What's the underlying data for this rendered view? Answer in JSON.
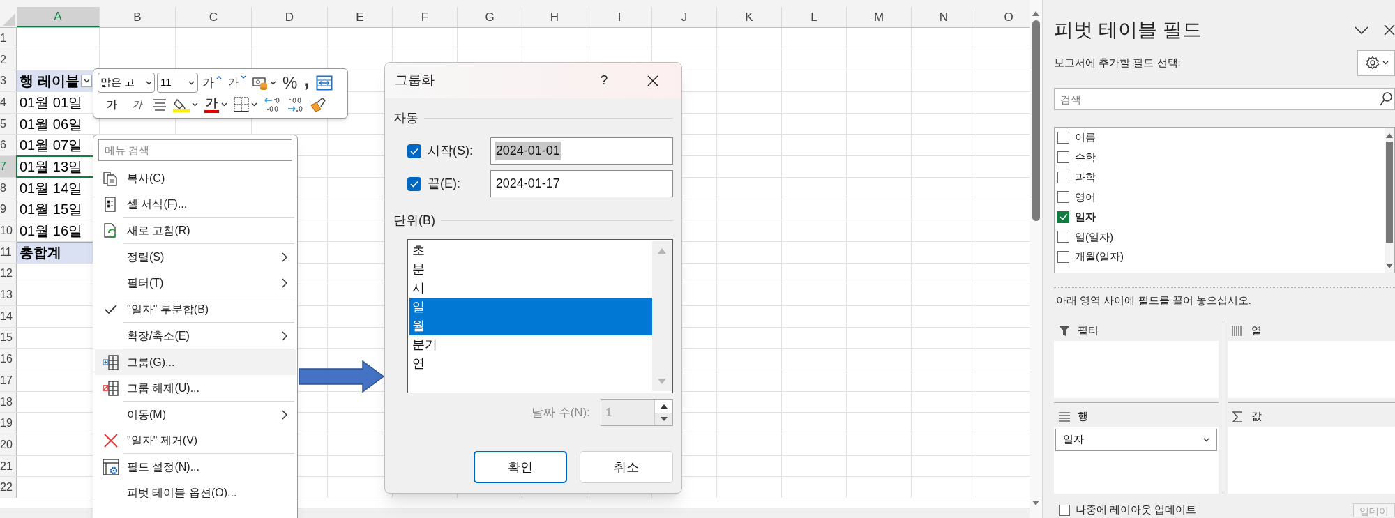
{
  "sheet": {
    "columns": [
      {
        "label": "A",
        "selected": true
      },
      {
        "label": "B",
        "selected": false
      },
      {
        "label": "C",
        "selected": false
      },
      {
        "label": "D",
        "selected": false
      },
      {
        "label": "E",
        "selected": false
      },
      {
        "label": "F",
        "selected": false
      },
      {
        "label": "G",
        "selected": false
      },
      {
        "label": "H",
        "selected": false
      },
      {
        "label": "I",
        "selected": false
      },
      {
        "label": "J",
        "selected": false
      },
      {
        "label": "K",
        "selected": false
      },
      {
        "label": "L",
        "selected": false
      },
      {
        "label": "M",
        "selected": false
      },
      {
        "label": "N",
        "selected": false
      },
      {
        "label": "O",
        "selected": false
      }
    ],
    "rows": [
      {
        "label": "1",
        "selected": false
      },
      {
        "label": "2",
        "selected": false
      },
      {
        "label": "3",
        "selected": false
      },
      {
        "label": "4",
        "selected": false
      },
      {
        "label": "5",
        "selected": false
      },
      {
        "label": "6",
        "selected": false
      },
      {
        "label": "7",
        "selected": true
      },
      {
        "label": "8",
        "selected": false
      },
      {
        "label": "9",
        "selected": false
      },
      {
        "label": "10",
        "selected": false
      },
      {
        "label": "11",
        "selected": false
      },
      {
        "label": "12",
        "selected": false
      },
      {
        "label": "13",
        "selected": false
      },
      {
        "label": "14",
        "selected": false
      },
      {
        "label": "15",
        "selected": false
      },
      {
        "label": "16",
        "selected": false
      },
      {
        "label": "17",
        "selected": false
      },
      {
        "label": "18",
        "selected": false
      },
      {
        "label": "19",
        "selected": false
      },
      {
        "label": "20",
        "selected": false
      },
      {
        "label": "21",
        "selected": false
      },
      {
        "label": "22",
        "selected": false
      }
    ]
  },
  "pivot_table": {
    "cells": [
      {
        "kind": "header",
        "text": "행 레이블",
        "selected": false
      },
      {
        "kind": "item",
        "text": "01월 01일",
        "selected": false
      },
      {
        "kind": "item",
        "text": "01월 06일",
        "selected": false
      },
      {
        "kind": "item",
        "text": "01월 07일",
        "selected": false
      },
      {
        "kind": "item",
        "text": "01월 13일",
        "selected": true
      },
      {
        "kind": "item",
        "text": "01월 14일",
        "selected": false
      },
      {
        "kind": "item",
        "text": "01월 15일",
        "selected": false
      },
      {
        "kind": "item",
        "text": "01월 16일",
        "selected": false
      },
      {
        "kind": "total",
        "text": "총합계",
        "selected": false
      }
    ]
  },
  "mini_toolbar": {
    "font": "맑은 고",
    "size": "11",
    "top_tools": [
      {
        "kind": "grow",
        "glyph": "가"
      },
      {
        "kind": "shrink",
        "glyph": "가"
      },
      {
        "kind": "accounting"
      },
      {
        "kind": "percent",
        "glyph": "%"
      },
      {
        "kind": "comma",
        "glyph": ","
      },
      {
        "kind": "wrap"
      }
    ],
    "bottom_tools": [
      {
        "kind": "bold",
        "glyph": "가"
      },
      {
        "kind": "italic",
        "glyph": "가"
      },
      {
        "kind": "align"
      },
      {
        "kind": "fill"
      },
      {
        "kind": "font_color",
        "glyph": "가"
      },
      {
        "kind": "borders"
      },
      {
        "kind": "increase_decimal"
      },
      {
        "kind": "decrease_decimal"
      },
      {
        "kind": "format_painter"
      }
    ]
  },
  "context_menu": {
    "search_placeholder": "메뉴 검색",
    "items": [
      {
        "kind": "copy",
        "label": "복사(C)",
        "submenu": false,
        "checked": false,
        "highlighted": false
      },
      {
        "kind": "format",
        "label": "셀 서식(F)...",
        "submenu": false,
        "checked": false,
        "highlighted": false
      },
      {
        "kind": "separator"
      },
      {
        "kind": "refresh",
        "label": "새로 고침(R)",
        "submenu": false,
        "checked": false,
        "highlighted": false
      },
      {
        "kind": "separator"
      },
      {
        "kind": "item",
        "label": "정렬(S)",
        "submenu": true,
        "checked": false,
        "highlighted": false
      },
      {
        "kind": "item",
        "label": "필터(T)",
        "submenu": true,
        "checked": false,
        "highlighted": false
      },
      {
        "kind": "separator"
      },
      {
        "kind": "item",
        "label": "\"일자\" 부분합(B)",
        "submenu": false,
        "checked": true,
        "highlighted": false
      },
      {
        "kind": "separator"
      },
      {
        "kind": "item",
        "label": "확장/축소(E)",
        "submenu": true,
        "checked": false,
        "highlighted": false
      },
      {
        "kind": "separator"
      },
      {
        "kind": "group",
        "label": "그룹(G)...",
        "submenu": false,
        "checked": false,
        "highlighted": true
      },
      {
        "kind": "ungroup",
        "label": "그룹 해제(U)...",
        "submenu": false,
        "checked": false,
        "highlighted": false
      },
      {
        "kind": "separator"
      },
      {
        "kind": "item",
        "label": "이동(M)",
        "submenu": true,
        "checked": false,
        "highlighted": false
      },
      {
        "kind": "remove",
        "label": "\"일자\" 제거(V)",
        "submenu": false,
        "checked": false,
        "highlighted": false
      },
      {
        "kind": "separator"
      },
      {
        "kind": "field_settings",
        "label": "필드 설정(N)...",
        "submenu": false,
        "checked": false,
        "highlighted": false
      },
      {
        "kind": "item",
        "label": "피벗 테이블 옵션(O)...",
        "submenu": false,
        "checked": false,
        "highlighted": false
      }
    ]
  },
  "group_dialog": {
    "title": "그룹화",
    "help": "?",
    "auto_section": "자동",
    "start": {
      "checked": true,
      "label": "시작(S):",
      "value": "2024-01-01",
      "value_selected": true
    },
    "end": {
      "checked": true,
      "label": "끝(E):",
      "value": "2024-01-17",
      "value_selected": false
    },
    "unit_section": "단위(B)",
    "units": [
      {
        "label": "초",
        "selected": false
      },
      {
        "label": "분",
        "selected": false
      },
      {
        "label": "시",
        "selected": false
      },
      {
        "label": "일",
        "selected": true
      },
      {
        "label": "월",
        "selected": true
      },
      {
        "label": "분기",
        "selected": false
      },
      {
        "label": "연",
        "selected": false
      }
    ],
    "days_label": "날짜 수(N):",
    "days_value": "1",
    "days_disabled": true,
    "buttons": [
      {
        "label": "확인",
        "default": true
      },
      {
        "label": "취소",
        "default": false
      }
    ]
  },
  "pivot_pane": {
    "title": "피벗 테이블 필드",
    "subtitle": "보고서에 추가할 필드 선택:",
    "search_placeholder": "검색",
    "fields": [
      {
        "label": "이름",
        "checked": false
      },
      {
        "label": "수학",
        "checked": false
      },
      {
        "label": "과학",
        "checked": false
      },
      {
        "label": "영어",
        "checked": false
      },
      {
        "label": "일자",
        "checked": true
      },
      {
        "label": "일(일자)",
        "checked": false
      },
      {
        "label": "개월(일자)",
        "checked": false
      }
    ],
    "instruction": "아래 영역 사이에 필드를 끌어 놓으십시오.",
    "areas": [
      {
        "kind": "filter",
        "label": "필터"
      },
      {
        "kind": "columns",
        "label": "열"
      },
      {
        "kind": "rows",
        "label": "행",
        "items": [
          "일자"
        ]
      },
      {
        "kind": "values",
        "label": "값"
      }
    ],
    "defer_update": {
      "label": "나중에 레이아웃 업데이트",
      "checked": false
    },
    "update_button": "업데이"
  }
}
